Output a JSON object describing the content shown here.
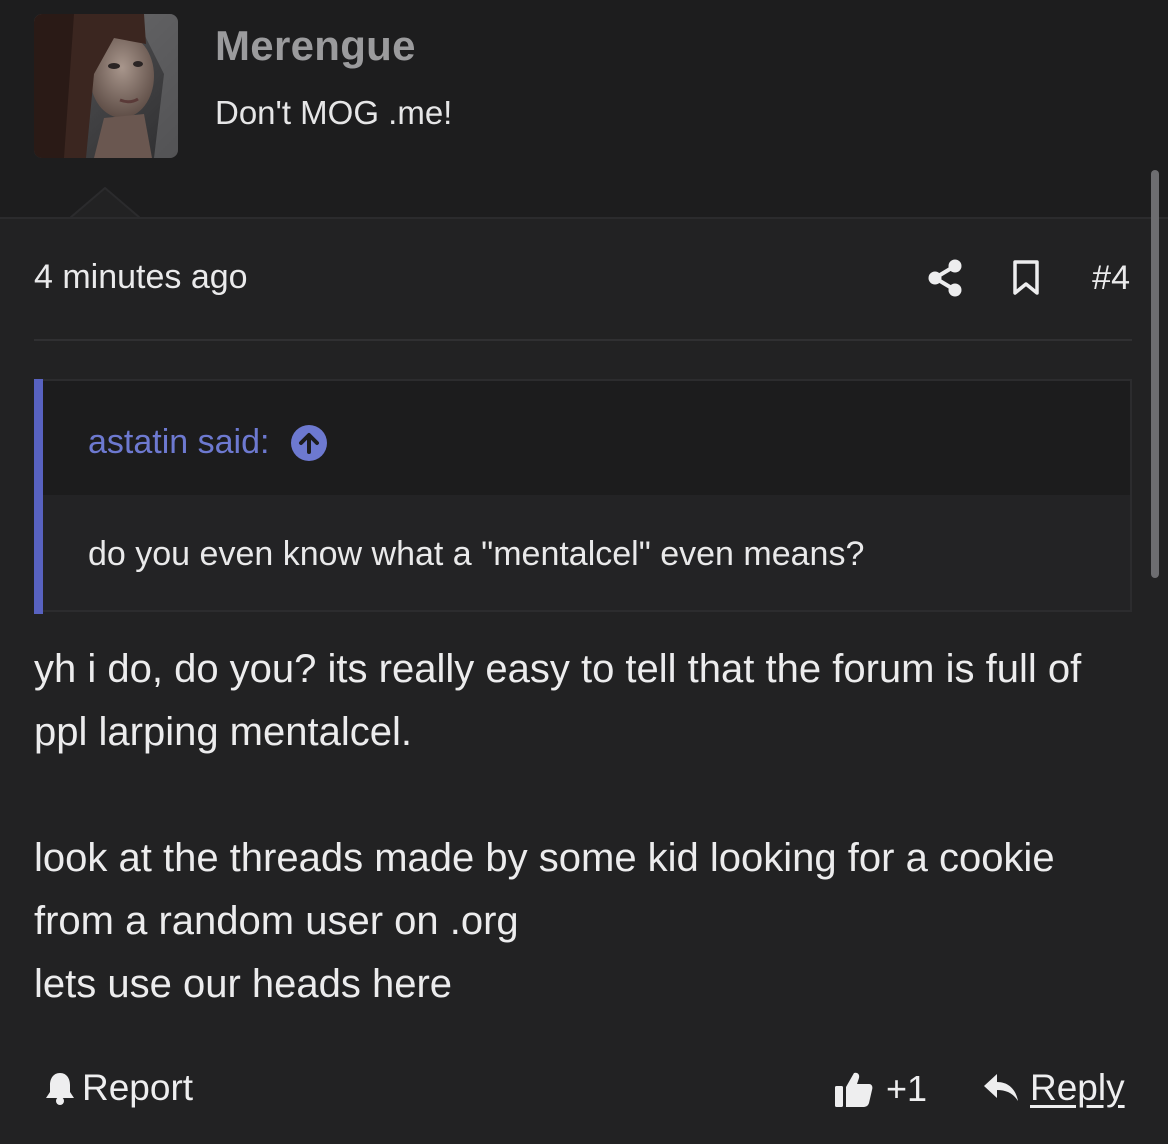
{
  "user": {
    "name": "Merengue",
    "title": "Don't MOG .me!"
  },
  "post": {
    "time": "4 minutes ago",
    "number": "#4"
  },
  "quote": {
    "author_label": "astatin said:",
    "text": "do you even know what a \"mentalcel\" even means?"
  },
  "message": {
    "paragraph1": "yh i do, do you? its really easy to tell that the forum is full of ppl larping mentalcel.",
    "line2": "look at the threads made by some kid looking for a cookie from a random user on .org",
    "line3": "lets use our heads here"
  },
  "actions": {
    "report_label": "Report",
    "like_count": "+1",
    "reply_label": "Reply"
  },
  "icons": {
    "share": "share-icon",
    "bookmark": "bookmark-icon",
    "quote_jump": "arrow-up-circle-icon",
    "report": "bell-icon",
    "like": "thumbs-up-icon",
    "reply": "reply-arrow-icon"
  },
  "colors": {
    "background": "#222223",
    "header_background": "#1d1d1e",
    "quote_accent": "#5862c0",
    "quote_author": "#6d79d0",
    "username": "#9b9b9d"
  }
}
